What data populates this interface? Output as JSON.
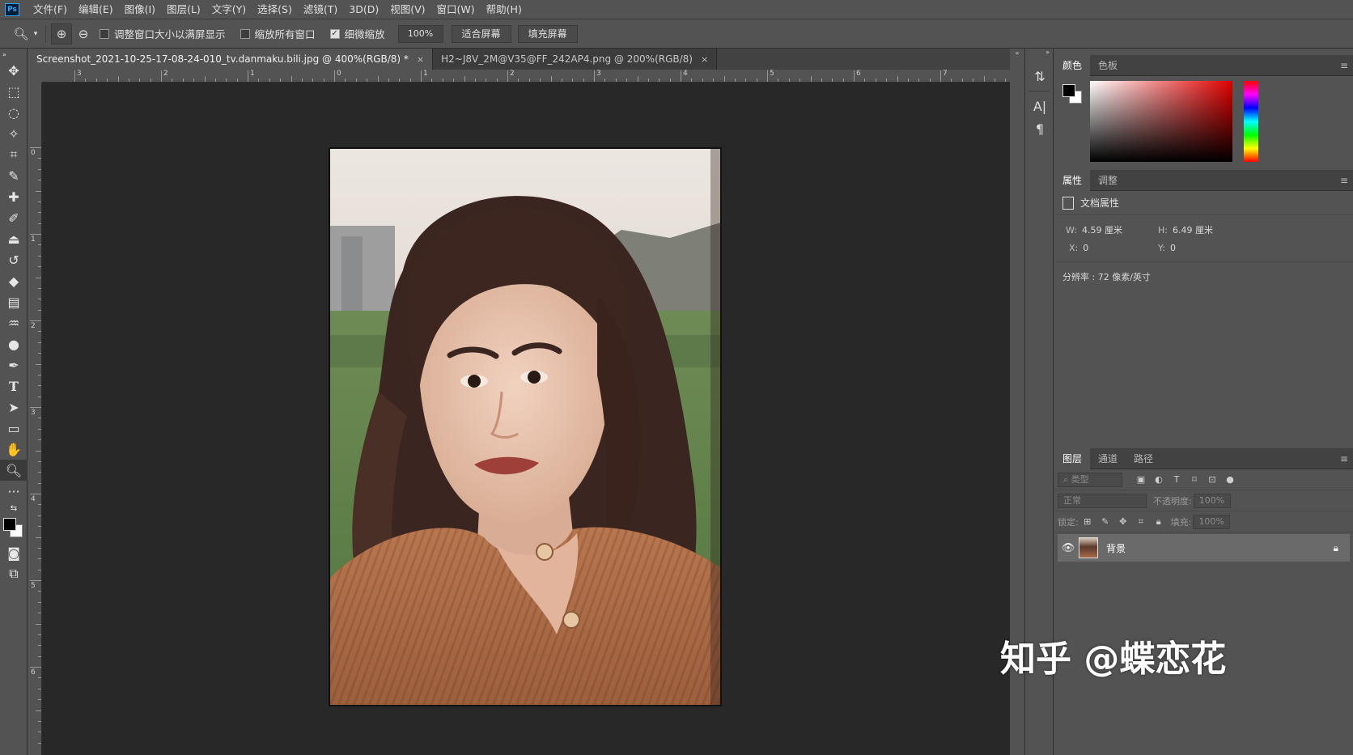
{
  "menu": {
    "logo": "Ps",
    "items": [
      "文件(F)",
      "编辑(E)",
      "图像(I)",
      "图层(L)",
      "文字(Y)",
      "选择(S)",
      "滤镜(T)",
      "3D(D)",
      "视图(V)",
      "窗口(W)",
      "帮助(H)"
    ]
  },
  "options": {
    "resize_windows": "调整窗口大小以满屏显示",
    "zoom_all": "缩放所有窗口",
    "scrubby_zoom": "细微缩放",
    "zoom_value": "100%",
    "fit_screen": "适合屏幕",
    "fill_screen": "填充屏幕"
  },
  "tabs": [
    {
      "label": "Screenshot_2021-10-25-17-08-24-010_tv.danmaku.bili.jpg @ 400%(RGB/8) *",
      "close": "×"
    },
    {
      "label": "H2~J8V_2M@V35@FF_242AP4.png @ 200%(RGB/8)",
      "close": "×"
    }
  ],
  "ruler": {
    "top_labels": [
      "3",
      "2",
      "1",
      "0",
      "1",
      "2",
      "3",
      "4",
      "5",
      "6",
      "7"
    ],
    "left_labels": [
      "0",
      "1",
      "2",
      "3",
      "4",
      "5",
      "6"
    ]
  },
  "color_panel": {
    "tabs": [
      "颜色",
      "色板"
    ],
    "foreground": "#000000",
    "background": "#ffffff"
  },
  "properties_panel": {
    "tabs": [
      "属性",
      "调整"
    ],
    "title": "文档属性",
    "w_label": "W:",
    "w_value": "4.59 厘米",
    "h_label": "H:",
    "h_value": "6.49 厘米",
    "x_label": "X:",
    "x_value": "0",
    "y_label": "Y:",
    "y_value": "0",
    "resolution": "分辨率 : 72 像素/英寸"
  },
  "layers_panel": {
    "tabs": [
      "图层",
      "通道",
      "路径"
    ],
    "filter_placeholder": "类型",
    "blend_mode": "正常",
    "opacity_label": "不透明度:",
    "opacity_value": "100%",
    "lock_label": "锁定:",
    "fill_label": "填充:",
    "fill_value": "100%",
    "layer_name": "背景"
  },
  "watermark": "知乎 @蝶恋花"
}
